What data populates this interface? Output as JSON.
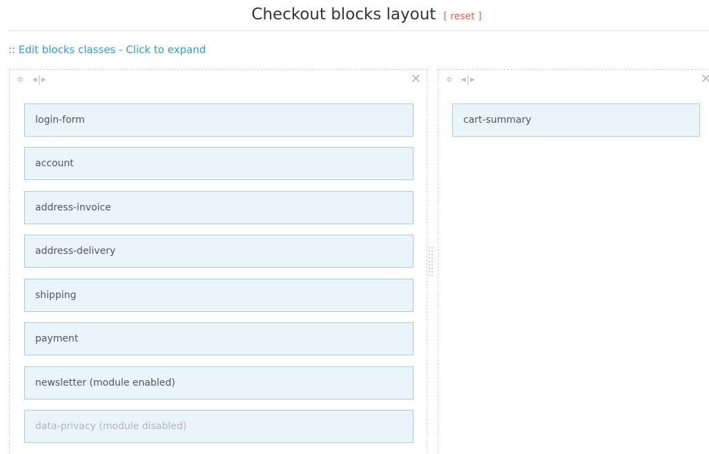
{
  "header": {
    "title": "Checkout blocks layout",
    "reset_label": "[ reset ]"
  },
  "edit_link": {
    "prefix": "::",
    "label": "Edit blocks classes - Click to expand"
  },
  "columns": [
    {
      "tools": {
        "move_icon": "≑",
        "resize_icon": "◂|▸"
      },
      "close_icon": "✕",
      "blocks": [
        {
          "label": "login-form"
        },
        {
          "label": "account"
        },
        {
          "label": "address-invoice"
        },
        {
          "label": "address-delivery"
        },
        {
          "label": "shipping"
        },
        {
          "label": "payment"
        },
        {
          "label": "newsletter (module enabled)"
        },
        {
          "label": "data-privacy (module disabled)"
        }
      ]
    },
    {
      "tools": {
        "move_icon": "≑",
        "resize_icon": "◂|▸"
      },
      "close_icon": "✕",
      "blocks": [
        {
          "label": "cart-summary"
        }
      ]
    }
  ],
  "colors": {
    "block_bg": "#eaf4fb",
    "block_border": "#a6cde6",
    "link": "#2a9fd6",
    "reset": "#f05a5a",
    "disabled_text": "#b5b5b5"
  }
}
